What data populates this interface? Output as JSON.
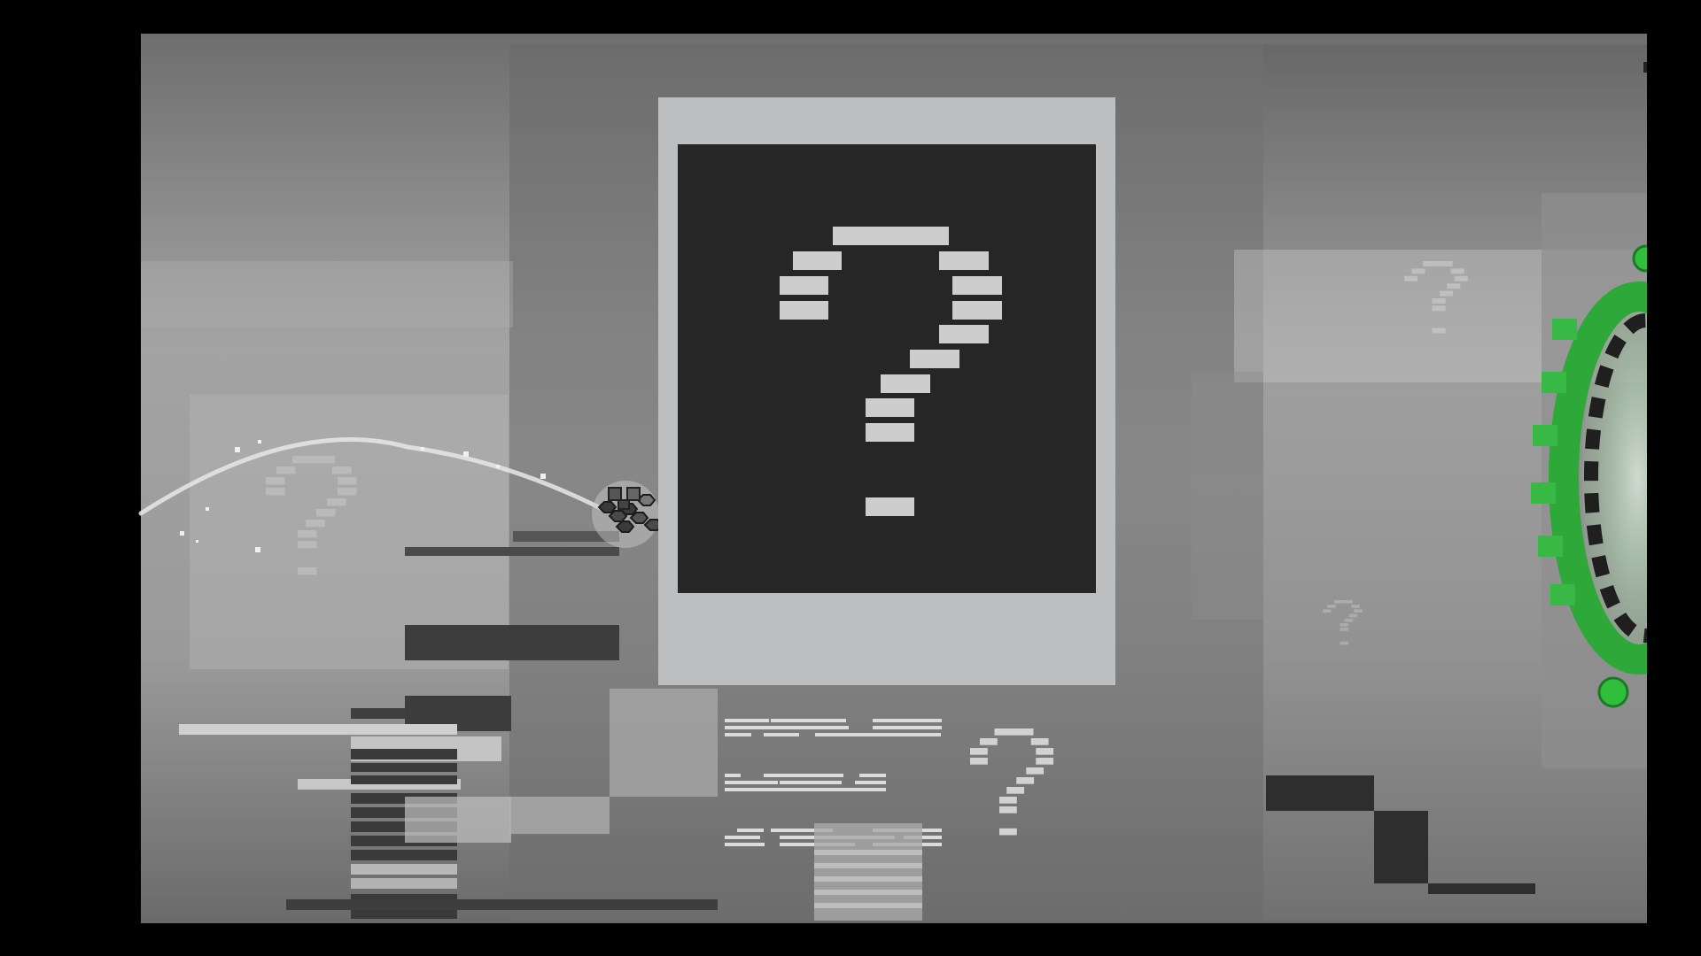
{
  "game": {
    "title": "",
    "mystery_glyph": "?",
    "player": {
      "icon": "hexagon-cluster-robot",
      "trail": "arc"
    },
    "objects": {
      "mystery_panel": "question-mark-block",
      "portal": "green-ring-portal"
    }
  },
  "colors": {
    "letterbox": "#000000",
    "background_light": "#a6a6a6",
    "background_mid": "#8a8a8a",
    "panel_frame": "#bebfc0",
    "panel_screen": "#262626",
    "glyph": "#c9c9c9",
    "dark_block": "#3a3a3a",
    "portal_green": "#2fa83a",
    "portal_dark": "#1f1f1f"
  }
}
